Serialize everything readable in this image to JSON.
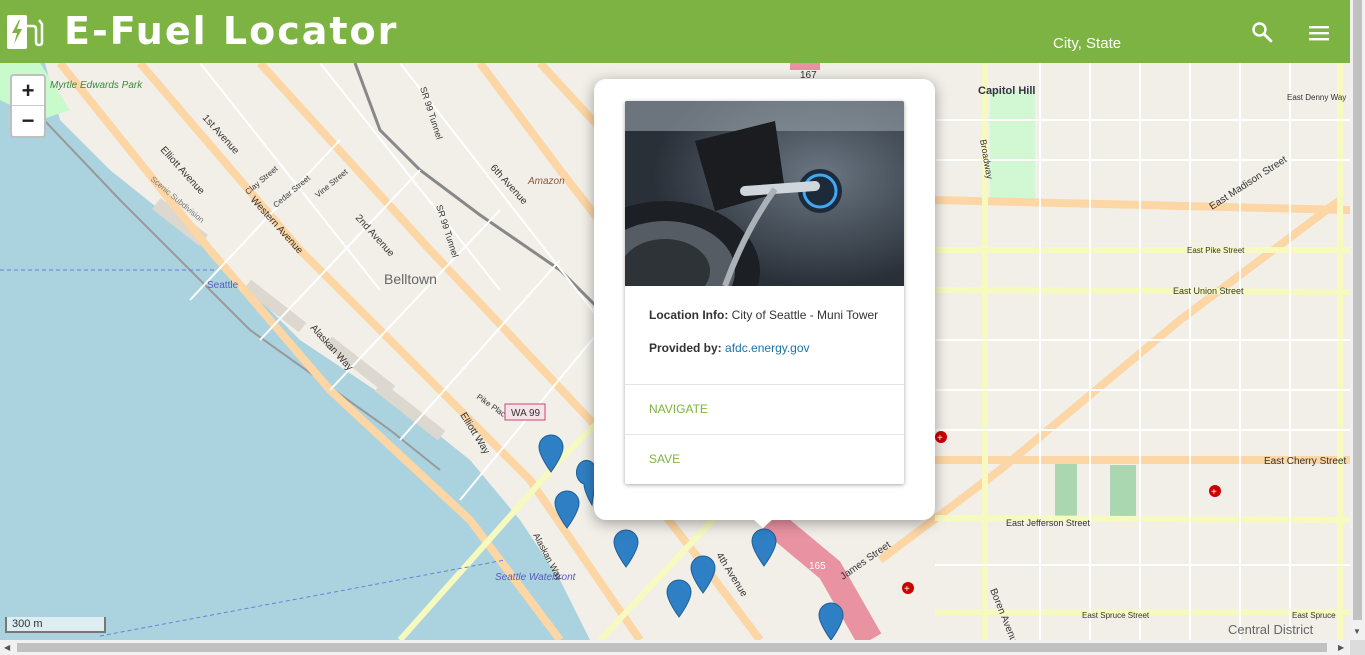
{
  "header": {
    "app_title": "E-Fuel Locator",
    "location": "City, State",
    "logo_icon": "ev-charging-icon",
    "search_icon": "search-icon",
    "menu_icon": "menu-icon",
    "color": "#7cb342"
  },
  "map": {
    "zoom_in": "+",
    "zoom_out": "−",
    "scale_label": "300 m",
    "labels": {
      "belltown": "Belltown",
      "capitol_hill": "Capitol Hill",
      "seattle": "Seattle",
      "seattle_waterfront": "Seattle Waterfront",
      "central_district": "Central District",
      "myrtle_edwards_park": "Myrtle Edwards Park",
      "amazon": "Amazon",
      "wa99": "WA 99",
      "i5": "165",
      "i5_top": "167",
      "e_madison": "East Madison Street",
      "e_pike": "East Pike Street",
      "e_union": "East Union Street",
      "e_cherry": "East Cherry Street",
      "e_jefferson": "East Jefferson Street",
      "e_spruce": "East Spruce Street",
      "e_spruce2": "East Spruce",
      "e_denny": "East Denny Way",
      "james": "James Street",
      "elliott_ave": "Elliott Avenue",
      "western_ave": "Western Avenue",
      "first_ave": "1st Avenue",
      "second_ave": "2nd Avenue",
      "sixth_ave": "6th Avenue",
      "alaskan_way": "Alaskan Way",
      "elliott_way": "Elliott Way",
      "pike_place": "Pike Place",
      "sr99": "SR 99 Tunnel",
      "fourth_ave": "4th Avenue",
      "broadway": "Broadway",
      "boren": "Boren Avenue",
      "scenic_sub": "Scenic Subdivision",
      "clay": "Clay Street",
      "cedar": "Cedar Street",
      "vine": "Vine Street"
    }
  },
  "popup": {
    "image_alt": "EV charger plugged into car",
    "location_label": "Location Info:",
    "location_value": "City of Seattle - Muni Tower",
    "provider_label": "Provided by:",
    "provider_value": "afdc.energy.gov",
    "navigate": "NAVIGATE",
    "save": "SAVE"
  }
}
